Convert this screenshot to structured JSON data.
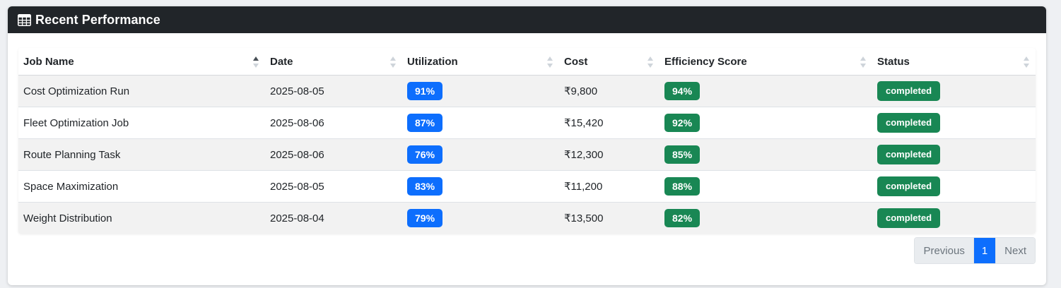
{
  "header": {
    "icon": "table-icon",
    "title": "Recent Performance"
  },
  "table": {
    "columns": [
      "Job Name",
      "Date",
      "Utilization",
      "Cost",
      "Efficiency Score",
      "Status"
    ],
    "sorted_column": "Job Name",
    "sort_direction": "ascending",
    "rows": [
      {
        "job": "Cost Optimization Run",
        "date": "2025-08-05",
        "utilization": "91%",
        "cost": "₹9,800",
        "efficiency": "94%",
        "status": "completed"
      },
      {
        "job": "Fleet Optimization Job",
        "date": "2025-08-06",
        "utilization": "87%",
        "cost": "₹15,420",
        "efficiency": "92%",
        "status": "completed"
      },
      {
        "job": "Route Planning Task",
        "date": "2025-08-06",
        "utilization": "76%",
        "cost": "₹12,300",
        "efficiency": "85%",
        "status": "completed"
      },
      {
        "job": "Space Maximization",
        "date": "2025-08-05",
        "utilization": "83%",
        "cost": "₹11,200",
        "efficiency": "88%",
        "status": "completed"
      },
      {
        "job": "Weight Distribution",
        "date": "2025-08-04",
        "utilization": "79%",
        "cost": "₹13,500",
        "efficiency": "82%",
        "status": "completed"
      }
    ]
  },
  "pagination": {
    "previous": "Previous",
    "current": "1",
    "next": "Next"
  },
  "colors": {
    "header_bg": "#212529",
    "utilization_badge": "#0d6efd",
    "efficiency_badge": "#198754",
    "status_badge": "#198754",
    "active_page": "#0d6efd"
  }
}
